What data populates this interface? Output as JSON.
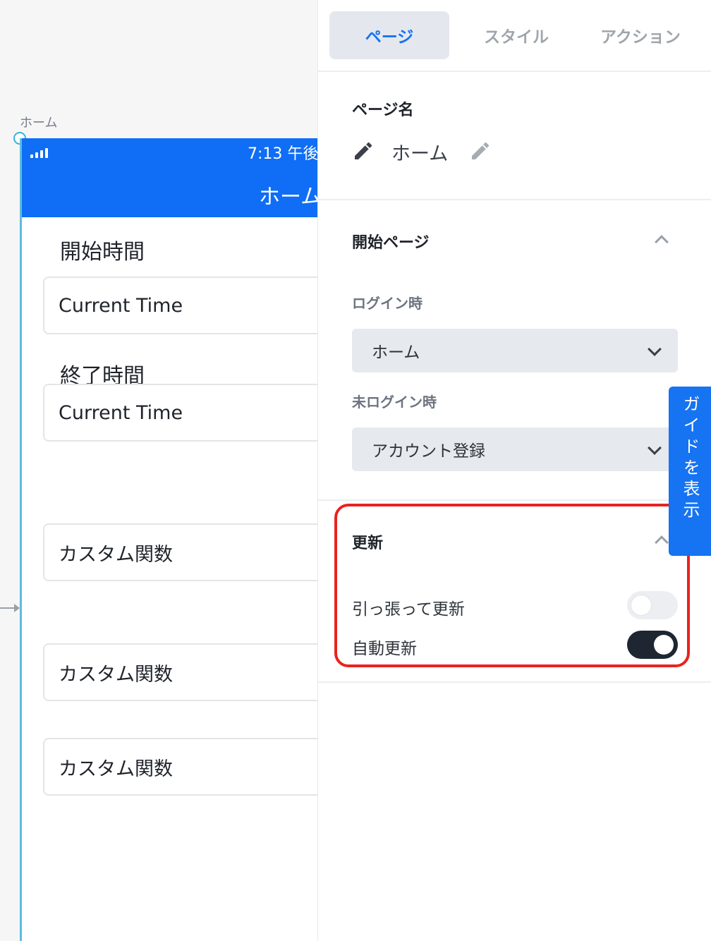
{
  "canvas": {
    "screen_label": "ホーム",
    "status_time": "7:13 午後",
    "nav_title": "ホーム",
    "start_label": "開始時間",
    "start_value": "Current Time",
    "end_label": "終了時間",
    "end_value": "Current Time",
    "custom_functions": [
      "カスタム関数",
      "カスタム関数",
      "カスタム関数"
    ]
  },
  "panel": {
    "tabs": [
      "ページ",
      "スタイル",
      "アクション"
    ],
    "active_tab": "ページ",
    "page_name_title": "ページ名",
    "page_name_value": "ホーム",
    "start_page_title": "開始ページ",
    "login_label": "ログイン時",
    "login_value": "ホーム",
    "not_logged_in_label": "未ログイン時",
    "not_logged_in_value": "アカウント登録",
    "refresh_title": "更新",
    "pull_to_refresh_label": "引っ張って更新",
    "pull_to_refresh_on": false,
    "auto_refresh_label": "自動更新",
    "auto_refresh_on": true
  },
  "guide_button": "ガイドを表示",
  "colors": {
    "brand_blue": "#0f6ef5",
    "tab_active": "#1673f2",
    "toggle_on": "#1e2632",
    "highlight": "#e8231e"
  },
  "icons": [
    "signal-icon",
    "pencil-icon",
    "edit-icon",
    "chevron-down-icon",
    "chevron-up-icon"
  ]
}
